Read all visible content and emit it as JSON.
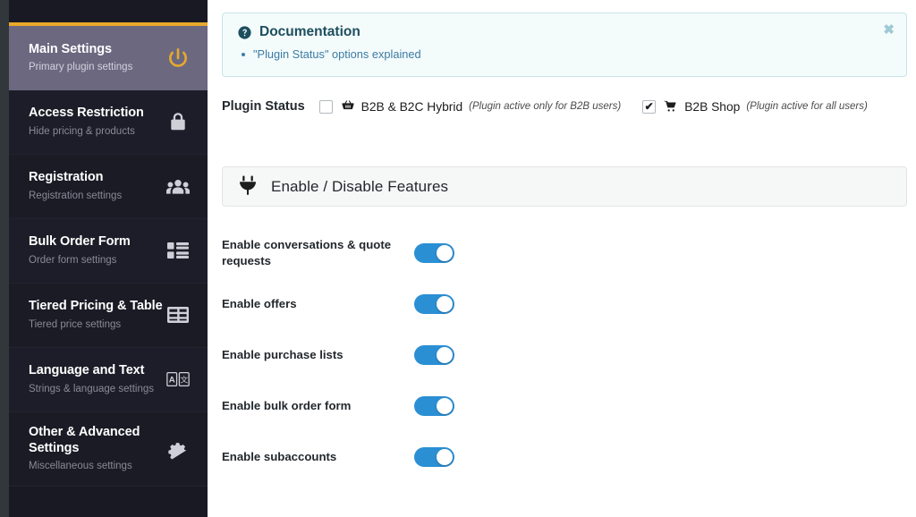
{
  "sidebar": {
    "items": [
      {
        "title": "Main Settings",
        "subtitle": "Primary plugin settings",
        "icon": "power-icon",
        "active": true
      },
      {
        "title": "Access Restriction",
        "subtitle": "Hide pricing & products",
        "icon": "lock-icon",
        "active": false
      },
      {
        "title": "Registration",
        "subtitle": "Registration settings",
        "icon": "users-icon",
        "active": false
      },
      {
        "title": "Bulk Order Form",
        "subtitle": "Order form settings",
        "icon": "list-icon",
        "active": false
      },
      {
        "title": "Tiered Pricing & Table",
        "subtitle": "Tiered price settings",
        "icon": "table-icon",
        "active": false
      },
      {
        "title": "Language and Text",
        "subtitle": "Strings & language settings",
        "icon": "translate-icon",
        "active": false
      },
      {
        "title": "Other & Advanced Settings",
        "subtitle": "Miscellaneous settings",
        "icon": "gear-icon",
        "active": false
      }
    ],
    "active_accent_color": "#e8a92b",
    "active_bg_color": "#6b6880",
    "bg_color": "#191923"
  },
  "documentation": {
    "heading": "Documentation",
    "heading_icon": "question-circle-icon",
    "links": [
      {
        "text": "\"Plugin Status\" options explained"
      }
    ],
    "close_label": "✖",
    "border_color": "#c6e4e8",
    "bg_color": "#f4fbfb",
    "link_color": "#3a7ca5"
  },
  "plugin_status": {
    "label": "Plugin Status",
    "options": [
      {
        "name": "B2B & B2C Hybrid",
        "hint": "(Plugin active only for B2B users)",
        "icon": "shopping-basket-icon",
        "checked": false
      },
      {
        "name": "B2B Shop",
        "hint": "(Plugin active for all users)",
        "icon": "shopping-cart-icon",
        "checked": true
      }
    ]
  },
  "features_panel": {
    "title": "Enable / Disable Features",
    "icon": "plug-icon",
    "toggle_on_color": "#2b8fd4",
    "toggles": [
      {
        "label": "Enable conversations & quote requests",
        "on": true
      },
      {
        "label": "Enable offers",
        "on": true
      },
      {
        "label": "Enable purchase lists",
        "on": true
      },
      {
        "label": "Enable bulk order form",
        "on": true
      },
      {
        "label": "Enable subaccounts",
        "on": true
      }
    ]
  }
}
